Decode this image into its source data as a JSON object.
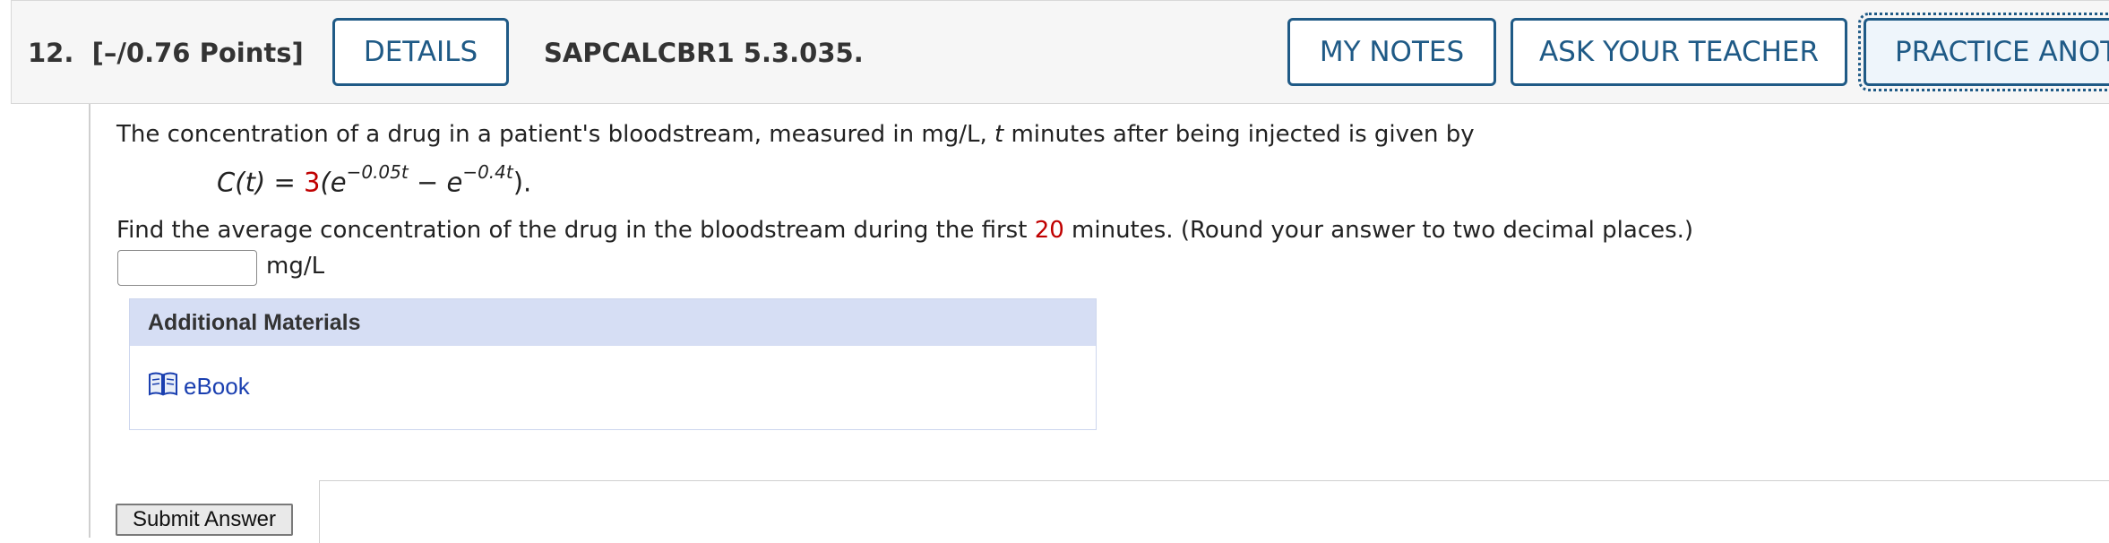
{
  "header": {
    "question_number": "12.",
    "points": "[–/0.76 Points]",
    "details_button": "DETAILS",
    "question_id": "SAPCALCBR1 5.3.035.",
    "my_notes_button": "MY NOTES",
    "ask_teacher_button": "ASK YOUR TEACHER",
    "practice_button": "PRACTICE ANOTHER"
  },
  "problem": {
    "intro_part1": "The concentration of a drug in a patient's bloodstream, measured in mg/L, ",
    "intro_var": "t",
    "intro_part2": " minutes after being injected is given by",
    "formula": {
      "lhs": "C(t) = ",
      "coef": "3",
      "open": "(e",
      "exp1": "−0.05t",
      "mid": " − e",
      "exp2": "−0.4t",
      "close": ")."
    },
    "question_part1": "Find the average concentration of the drug in the bloodstream during the first ",
    "question_highlight": "20",
    "question_part2": " minutes. (Round your answer to two decimal places.)",
    "answer_value": "",
    "unit": "mg/L"
  },
  "additional_materials": {
    "title": "Additional Materials",
    "ebook_label": "eBook",
    "ebook_icon": "book-icon"
  },
  "submit_label": "Submit Answer",
  "colors": {
    "accent": "#1f5a86",
    "highlight_red": "#c00000",
    "materials_header": "#d6def4",
    "link": "#1a3fb0"
  }
}
